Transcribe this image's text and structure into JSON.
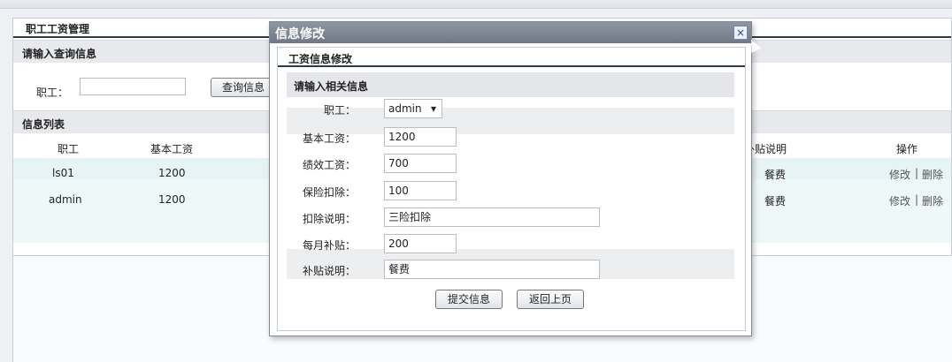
{
  "page": {
    "title": "职工工资管理",
    "query_section": "请输入查询信息",
    "query_label": "职工：",
    "query_value": "",
    "query_button": "查询信息",
    "list_section": "信息列表",
    "columns": [
      "职工",
      "基本工资",
      "补贴说明",
      "操作"
    ],
    "rows": [
      {
        "employee": "ls01",
        "base": "1200",
        "subsidy_note": "餐费",
        "edit": "修改",
        "sep": "|",
        "delete": "删除"
      },
      {
        "employee": "admin",
        "base": "1200",
        "subsidy_note": "餐费",
        "edit": "修改",
        "sep": "|",
        "delete": "删除"
      }
    ]
  },
  "dialog": {
    "title": "信息修改",
    "close_glyph": "×",
    "subtitle": "工资信息修改",
    "prompt": "请输入相关信息",
    "fields": {
      "employee": {
        "label": "职工：",
        "value": "admin"
      },
      "base_salary": {
        "label": "基本工资：",
        "value": "1200"
      },
      "performance": {
        "label": "绩效工资：",
        "value": "700"
      },
      "insurance": {
        "label": "保险扣除：",
        "value": "100"
      },
      "deduction_note": {
        "label": "扣除说明：",
        "value": "三险扣除"
      },
      "monthly_subsidy": {
        "label": "每月补贴：",
        "value": "200"
      },
      "subsidy_note": {
        "label": "补贴说明：",
        "value": "餐费"
      }
    },
    "submit": "提交信息",
    "back": "返回上页"
  }
}
